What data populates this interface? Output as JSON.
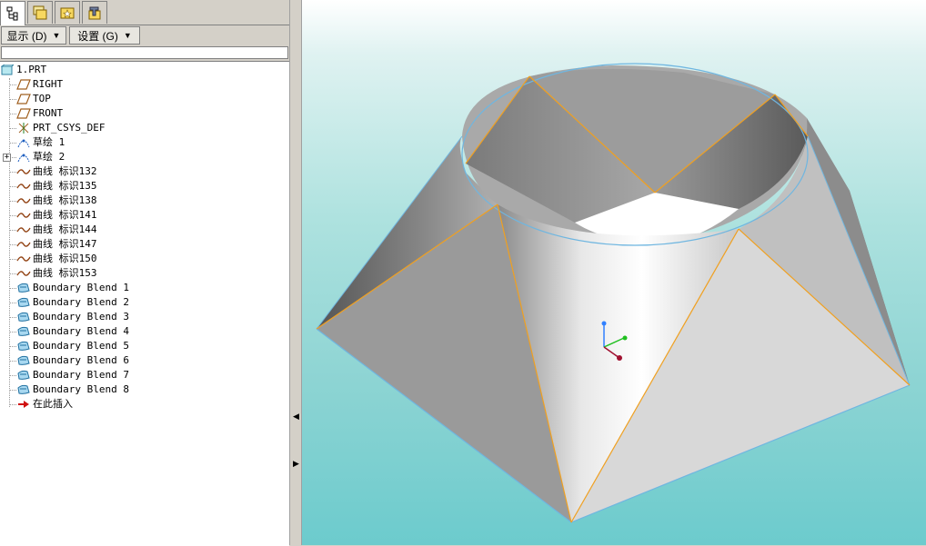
{
  "tabs": [
    {
      "name": "model-tree",
      "icon": "tree-icon"
    },
    {
      "name": "folder-browser",
      "icon": "folder-icon"
    },
    {
      "name": "favorites",
      "icon": "favorites-icon"
    },
    {
      "name": "connections",
      "icon": "tools-icon"
    }
  ],
  "toolbar": {
    "show_label": "显示 (D)",
    "settings_label": "设置 (G)"
  },
  "tree": {
    "root": "1.PRT",
    "items": [
      {
        "label": "RIGHT",
        "icon": "datum-plane-icon"
      },
      {
        "label": "TOP",
        "icon": "datum-plane-icon"
      },
      {
        "label": "FRONT",
        "icon": "datum-plane-icon"
      },
      {
        "label": "PRT_CSYS_DEF",
        "icon": "csys-icon"
      },
      {
        "label": "草绘 1",
        "icon": "sketch-icon"
      },
      {
        "label": "草绘 2",
        "icon": "sketch-icon"
      },
      {
        "label": "曲线 标识132",
        "icon": "curve-icon"
      },
      {
        "label": "曲线 标识135",
        "icon": "curve-icon"
      },
      {
        "label": "曲线 标识138",
        "icon": "curve-icon"
      },
      {
        "label": "曲线 标识141",
        "icon": "curve-icon"
      },
      {
        "label": "曲线 标识144",
        "icon": "curve-icon"
      },
      {
        "label": "曲线 标识147",
        "icon": "curve-icon"
      },
      {
        "label": "曲线 标识150",
        "icon": "curve-icon"
      },
      {
        "label": "曲线 标识153",
        "icon": "curve-icon"
      },
      {
        "label": "Boundary Blend 1",
        "icon": "boundary-blend-icon"
      },
      {
        "label": "Boundary Blend 2",
        "icon": "boundary-blend-icon"
      },
      {
        "label": "Boundary Blend 3",
        "icon": "boundary-blend-icon"
      },
      {
        "label": "Boundary Blend 4",
        "icon": "boundary-blend-icon"
      },
      {
        "label": "Boundary Blend 5",
        "icon": "boundary-blend-icon"
      },
      {
        "label": "Boundary Blend 6",
        "icon": "boundary-blend-icon"
      },
      {
        "label": "Boundary Blend 7",
        "icon": "boundary-blend-icon"
      },
      {
        "label": "Boundary Blend 8",
        "icon": "boundary-blend-icon"
      },
      {
        "label": "在此插入",
        "icon": "insert-here-arrow-icon"
      }
    ]
  },
  "colors": {
    "edge_orange": "#f0a020",
    "edge_blue": "#6fb6e0",
    "csys_x": "#20c020",
    "csys_y": "#3080ff",
    "csys_z": "#a01030"
  }
}
